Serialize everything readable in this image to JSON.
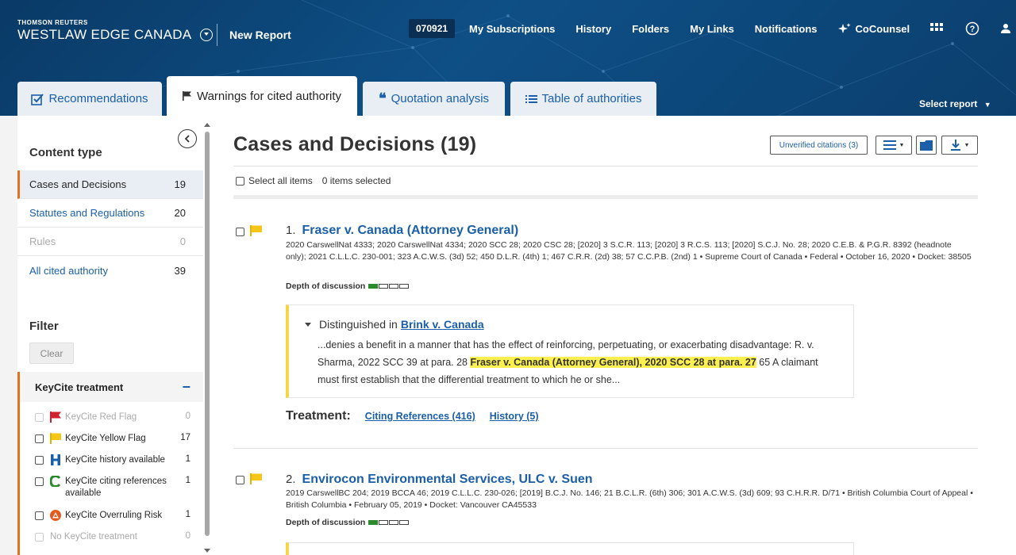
{
  "header": {
    "brand_small": "THOMSON REUTERS",
    "brand_big": "WESTLAW EDGE CANADA",
    "report_title": "New Report",
    "client_id": "070921",
    "nav": [
      "My Subscriptions",
      "History",
      "Folders",
      "My Links",
      "Notifications"
    ],
    "cocounsel": "CoCounsel"
  },
  "tabs": [
    {
      "label": "Recommendations",
      "active": false
    },
    {
      "label": "Warnings for cited authority",
      "active": true
    },
    {
      "label": "Quotation analysis",
      "active": false
    },
    {
      "label": "Table of authorities",
      "active": false
    }
  ],
  "select_report": "Select report",
  "sidebar": {
    "content_type_heading": "Content type",
    "content_types": [
      {
        "label": "Cases and Decisions",
        "count": "19"
      },
      {
        "label": "Statutes and Regulations",
        "count": "20"
      },
      {
        "label": "Rules",
        "count": "0"
      },
      {
        "label": "All cited authority",
        "count": "39"
      }
    ],
    "filter_heading": "Filter",
    "clear_label": "Clear",
    "keycite_heading": "KeyCite treatment",
    "keycite_items": [
      {
        "label": "KeyCite Red Flag",
        "count": "0"
      },
      {
        "label": "KeyCite Yellow Flag",
        "count": "17"
      },
      {
        "label": "KeyCite history available",
        "count": "1"
      },
      {
        "label": "KeyCite citing references available",
        "count": "1"
      },
      {
        "label": "KeyCite Overruling Risk",
        "count": "1"
      },
      {
        "label": "No KeyCite treatment",
        "count": "0"
      }
    ]
  },
  "main": {
    "title": "Cases and Decisions (19)",
    "unverified_label": "Unverified citations (3)",
    "select_all": "Select all items",
    "items_selected": "0 items selected",
    "depth_label": "Depth of discussion",
    "results": [
      {
        "number": "1.",
        "title": "Fraser v. Canada (Attorney General)",
        "citation": "2020 CarswellNat 4333; 2020 CarswellNat 4334; 2020 SCC 28; 2020 CSC 28; [2020] 3 S.C.R. 113; [2020] 3 R.C.S. 113; [2020] S.C.J. No. 28; 2020 C.E.B. & P.G.R. 8392 (headnote only); 2021 C.L.L.C. 230-001; 323 A.C.W.S. (3d) 52; 450 D.L.R. (4th) 1; 467 C.R.R. (2d) 38; 57 C.C.P.B. (2nd) 1 • Supreme Court of Canada • Federal • October 16, 2020 • Docket: 38505",
        "depth": 1,
        "quote_prefix": "Distinguished in",
        "quote_link": "Brink v. Canada",
        "quote_before": "...denies a benefit in a manner that has the effect of reinforcing, perpetuating, or exacerbating disadvantage: R. v. Sharma, 2022 SCC 39 at para. 28 ",
        "quote_highlight": "Fraser v. Canada (Attorney General), 2020 SCC 28 at para. 27",
        "quote_after": " 65    A claimant must first establish that the differential treatment to which he or she...",
        "treatment_label": "Treatment:",
        "citing_refs": "Citing References (416)",
        "history": "History (5)"
      },
      {
        "number": "2.",
        "title": "Envirocon Environmental Services, ULC v. Suen",
        "citation": "2019 CarswellBC 204; 2019 BCCA 46; 2019 C.L.L.C. 230-026; [2019] B.C.J. No. 146; 21 B.C.L.R. (6th) 306; 301 A.C.W.S. (3d) 609; 93 C.H.R.R. D/71 • British Columbia Court of Appeal • British Columbia • February 05, 2019 • Docket: Vancouver CA45533",
        "depth": 1
      }
    ]
  },
  "colors": {
    "header_blue": "#0e4f86",
    "link_blue": "#1a5fa8",
    "accent_orange": "#e37222",
    "yellow_flag": "#f5c518",
    "red_flag": "#d0202e",
    "highlight": "#fcf050"
  }
}
